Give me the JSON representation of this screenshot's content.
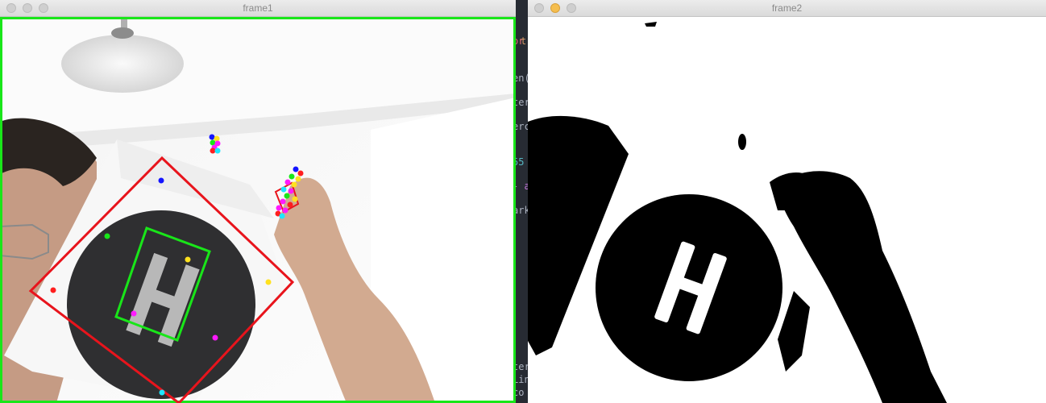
{
  "windows": {
    "frame1": {
      "title": "frame1"
    },
    "frame2": {
      "title": "frame2"
    }
  },
  "background_editor": {
    "fragments": [
      "or",
      "t",
      "en(",
      "ter",
      "erc",
      "55",
      "- a",
      "ark",
      "ter",
      "Lin",
      "co"
    ]
  },
  "colors": {
    "detection_green": "#19e619",
    "marker_red": "#e8141c",
    "helipad_dark": "#2f2f31",
    "threshold_black": "#000000",
    "threshold_white": "#ffffff",
    "point_colors": [
      "#1414ff",
      "#19e619",
      "#ffe11e",
      "#ff19ff",
      "#ff1e1e",
      "#1ee6ff"
    ]
  }
}
